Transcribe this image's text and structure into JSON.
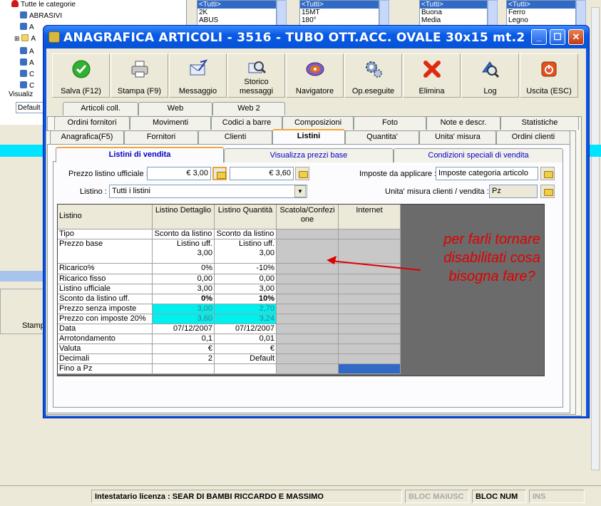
{
  "background": {
    "tree": [
      {
        "label": "Tutte le categorie",
        "icon": "heart-icon"
      },
      {
        "label": "ABRASIVI",
        "icon": "group-icon"
      },
      {
        "label": "A",
        "icon": "group-icon"
      },
      {
        "label": "A",
        "icon": "folder-icon"
      },
      {
        "label": "A",
        "icon": "group-icon"
      },
      {
        "label": "A",
        "icon": "group-icon"
      },
      {
        "label": "C",
        "icon": "group-icon"
      },
      {
        "label": "C",
        "icon": "group-icon"
      }
    ],
    "visualizza_label": "Visualiz",
    "default_value": "Default",
    "lists": [
      {
        "items": [
          "<Tutti>",
          "2K",
          "ABUS"
        ]
      },
      {
        "items": [
          "<Tutti>",
          "15MT",
          "180°"
        ]
      },
      {
        "items": [
          "<Tutti>",
          "Buona",
          "Media"
        ]
      },
      {
        "items": [
          "<Tutti>",
          "Ferro",
          "Legno"
        ]
      }
    ],
    "stamp_label": "Stamp"
  },
  "window": {
    "title": "ANAGRAFICA ARTICOLI - 3516 - TUBO OTT.ACC. OVALE 30x15 mt.2",
    "controls": {
      "minimize": "_",
      "maximize": "☐",
      "close": "✕"
    }
  },
  "toolbar": [
    {
      "id": "salva",
      "label": "Salva (F12)",
      "icon": "check-icon"
    },
    {
      "id": "stampa",
      "label": "Stampa (F9)",
      "icon": "printer-icon"
    },
    {
      "id": "messaggio",
      "label": "Messaggio",
      "icon": "envelope-icon"
    },
    {
      "id": "storico",
      "label": "Storico messaggi",
      "label2": "messaggi",
      "label1": "Storico",
      "icon": "search-mail-icon"
    },
    {
      "id": "navigatore",
      "label": "Navigatore",
      "icon": "compass-icon"
    },
    {
      "id": "opeseguite",
      "label": "Op.eseguite",
      "icon": "gears-icon"
    },
    {
      "id": "elimina",
      "label": "Elimina",
      "icon": "delete-x-icon"
    },
    {
      "id": "log",
      "label": "Log",
      "icon": "log-search-icon"
    },
    {
      "id": "uscita",
      "label": "Uscita (ESC)",
      "icon": "power-icon"
    }
  ],
  "tabs": {
    "row1": [
      "Articoli coll.",
      "Web",
      "Web 2"
    ],
    "row2": [
      "Ordini fornitori",
      "Movimenti",
      "Codici a barre",
      "Composizioni",
      "Foto",
      "Note e descr.",
      "Statistiche"
    ],
    "row3": [
      "Anagrafica(F5)",
      "Fornitori",
      "Clienti",
      "Listini",
      "Quantita'",
      "Unita' misura",
      "Ordini clienti"
    ],
    "active": "Listini"
  },
  "subtabs": {
    "items": [
      "Listini di vendita",
      "Visualizza prezzi base",
      "Condizioni speciali di vendita"
    ],
    "active": "Listini di vendita"
  },
  "form": {
    "prezzo_label": "Prezzo listino ufficiale :",
    "prezzo_value": "€ 3,00",
    "prezzo_ivato": "€ 3,60",
    "imposte_label": "Imposte da applicare :",
    "imposte_value": "Imposte categoria articolo",
    "listino_label": "Listino :",
    "listino_value": "Tutti i listini",
    "um_label": "Unita' misura clienti / vendita :",
    "um_value": "Pz"
  },
  "grid": {
    "headers": [
      "Listino",
      "Listino Dettaglio",
      "Listino Quantità",
      "Scatola/Confezi one",
      "Internet"
    ],
    "header3_line1": "Scatola/Confezi",
    "header3_line2": "one",
    "rows": [
      {
        "label": "Tipo",
        "dettaglio": "Sconto da listino",
        "quantita": "Sconto da listino"
      },
      {
        "label": "Prezzo base",
        "dettaglio": "Listino uff.",
        "dettaglio2": "3,00",
        "quantita": "Listino uff.",
        "quantita2": "3,00"
      },
      {
        "label": "Ricarico%",
        "dettaglio": "0%",
        "quantita": "-10%"
      },
      {
        "label": "Ricarico fisso",
        "dettaglio": "0,00",
        "quantita": "0,00"
      },
      {
        "label": "Listino ufficiale",
        "dettaglio": "3,00",
        "quantita": "3,00"
      },
      {
        "label": "Sconto da listino uff.",
        "dettaglio": "0%",
        "quantita": "10%"
      },
      {
        "label": "Prezzo senza imposte",
        "dettaglio": "3,00",
        "quantita": "2,70"
      },
      {
        "label": "Prezzo con imposte 20%",
        "dettaglio": "3,60",
        "quantita": "3,24"
      },
      {
        "label": "Data",
        "dettaglio": "07/12/2007",
        "quantita": "07/12/2007"
      },
      {
        "label": "Arrotondamento",
        "dettaglio": "0,1",
        "quantita": "0,01"
      },
      {
        "label": "Valuta",
        "dettaglio": "€",
        "quantita": "€"
      },
      {
        "label": "Decimali",
        "dettaglio": "2",
        "quantita": "Default"
      },
      {
        "label": "Fino a Pz",
        "dettaglio": "",
        "quantita": ""
      }
    ]
  },
  "annotation": "per farli tornare disabilitati cosa bisogna fare?",
  "statusbar": {
    "licenza": "Intestatario licenza : SEAR DI BAMBI RICCARDO E MASSIMO",
    "maiusc": "BLOC MAIUSC",
    "num": "BLOC NUM",
    "ins": "INS"
  }
}
